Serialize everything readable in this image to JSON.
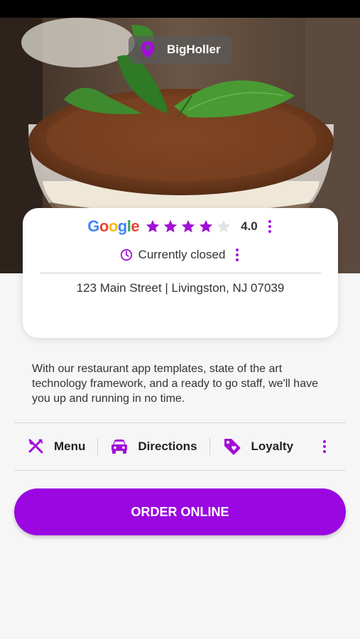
{
  "brand": {
    "name": "BigHoller",
    "accent_color": "#9a07e0"
  },
  "rating": {
    "provider": "Google",
    "provider_letters": [
      "G",
      "o",
      "o",
      "g",
      "l",
      "e"
    ],
    "value": "4.0",
    "stars_filled": 4,
    "stars_total": 5
  },
  "hours": {
    "status": "Currently closed"
  },
  "address": "123 Main Street | Livingston, NJ  07039",
  "description": "With our restaurant app templates, state of the art technology framework, and a ready to go staff, we'll have you up and running in no time.",
  "actions": [
    {
      "label": "Menu",
      "icon": "utensils-icon"
    },
    {
      "label": "Directions",
      "icon": "car-icon"
    },
    {
      "label": "Loyalty",
      "icon": "tag-icon"
    }
  ],
  "order_button": {
    "label": "ORDER ONLINE"
  }
}
